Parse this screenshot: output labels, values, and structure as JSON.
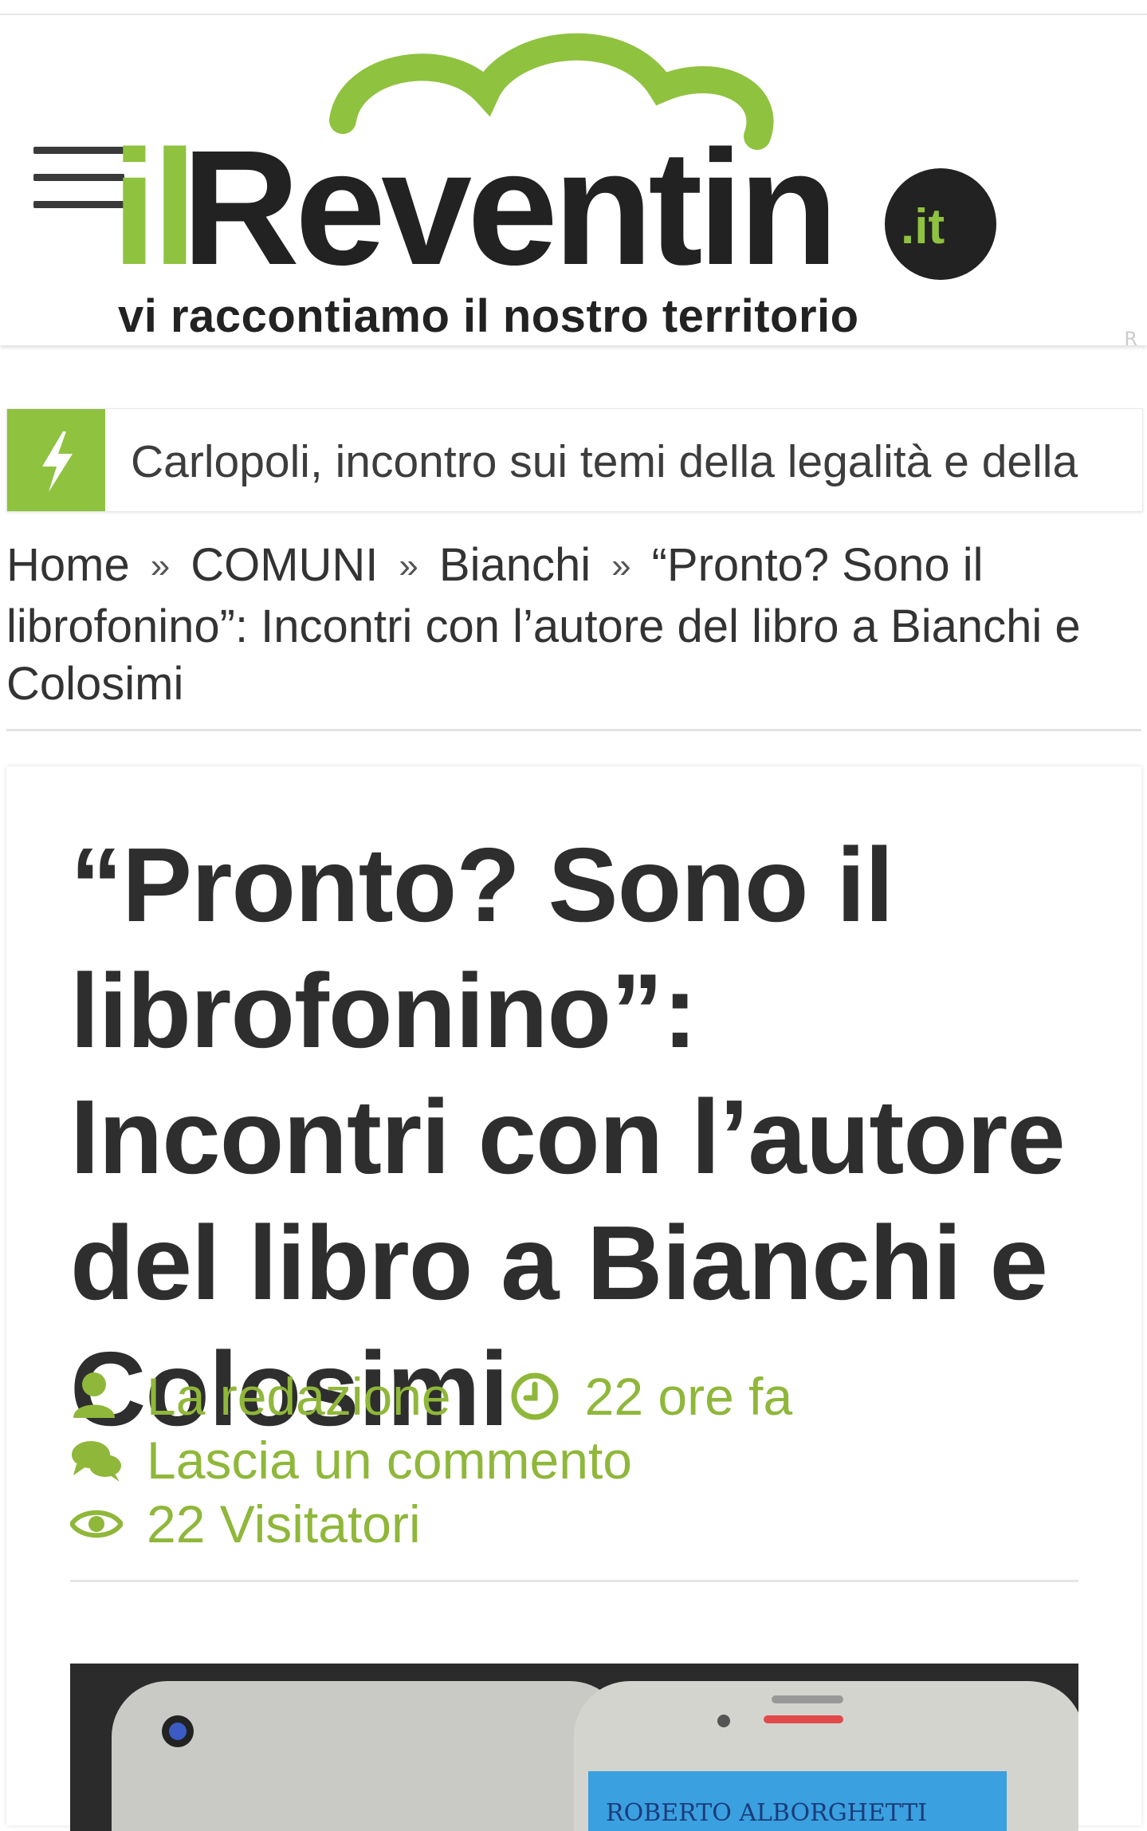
{
  "header": {
    "logo_word": "ilReventino",
    "logo_suffix": ".it",
    "tagline": "vi raccontiamo il nostro territorio",
    "colors": {
      "brand_green": "#8fc23f",
      "dark": "#222222"
    }
  },
  "ticker": {
    "icon": "lightning-bolt-icon",
    "headline": "Carlopoli, incontro sui temi della legalità e della"
  },
  "breadcrumb": {
    "items": [
      "Home",
      "COMUNI",
      "Bianchi"
    ],
    "separator": "»",
    "current": "“Pronto? Sono il librofonino”: Incontri con l’autore del libro a Bianchi e Colosimi"
  },
  "article": {
    "title": "“Pronto? Sono il librofonino”: Incontri con l’autore del libro a Bianchi e Colosimi",
    "author": "La redazione",
    "time_ago": "22 ore fa",
    "comment_link": "Lascia un commento",
    "visitors": "22 Visitatori",
    "accent_color": "#8fb73a",
    "image_caption_text": "ROBERTO ALBORGHETTI"
  }
}
